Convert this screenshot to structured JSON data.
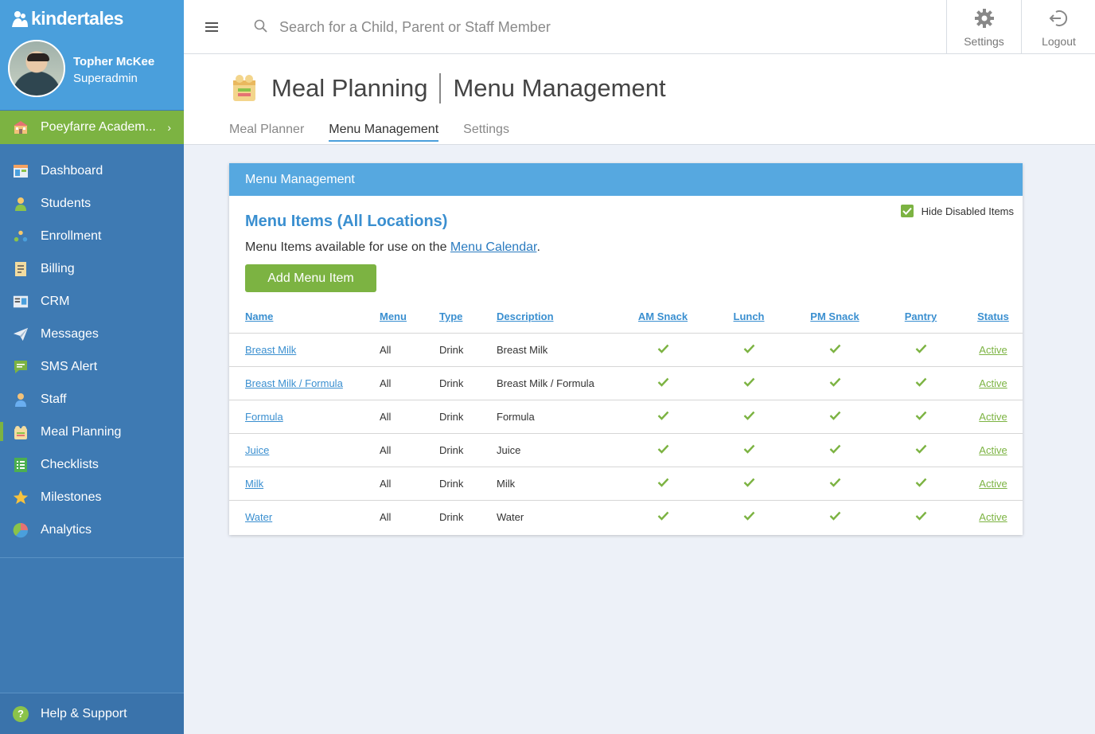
{
  "brand": {
    "name": "kindertales"
  },
  "user": {
    "name": "Topher McKee",
    "role": "Superadmin"
  },
  "school": {
    "name": "Poeyfarre Academ..."
  },
  "nav": [
    {
      "label": "Dashboard",
      "icon": "dashboard-icon",
      "color": "#e8eef5"
    },
    {
      "label": "Students",
      "icon": "students-icon",
      "color": "#f6c86a"
    },
    {
      "label": "Enrollment",
      "icon": "enrollment-icon",
      "color": "#f6c86a"
    },
    {
      "label": "Billing",
      "icon": "billing-icon",
      "color": "#f2dca0"
    },
    {
      "label": "CRM",
      "icon": "crm-icon",
      "color": "#e8eef5"
    },
    {
      "label": "Messages",
      "icon": "messages-icon",
      "color": "#e8eef5"
    },
    {
      "label": "SMS Alert",
      "icon": "sms-alert-icon",
      "color": "#7cb342"
    },
    {
      "label": "Staff",
      "icon": "staff-icon",
      "color": "#6aaef0"
    },
    {
      "label": "Meal Planning",
      "icon": "meal-planning-icon",
      "color": "#f2dca0",
      "active": true
    },
    {
      "label": "Checklists",
      "icon": "checklists-icon",
      "color": "#4caf50"
    },
    {
      "label": "Milestones",
      "icon": "milestones-icon",
      "color": "#f6c23e"
    },
    {
      "label": "Analytics",
      "icon": "analytics-icon",
      "color": "#e57373"
    }
  ],
  "help": {
    "label": "Help & Support"
  },
  "topbar": {
    "search_placeholder": "Search for a Child, Parent or Staff Member",
    "settings_label": "Settings",
    "logout_label": "Logout"
  },
  "page": {
    "title": "Meal Planning",
    "subtitle": "Menu Management",
    "tabs": [
      {
        "label": "Meal Planner",
        "active": false
      },
      {
        "label": "Menu Management",
        "active": true
      },
      {
        "label": "Settings",
        "active": false
      }
    ]
  },
  "card": {
    "header": "Menu Management",
    "title": "Menu Items (All Locations)",
    "desc_prefix": "Menu Items available for use on the ",
    "desc_link": "Menu Calendar",
    "desc_suffix": ".",
    "hide_disabled_label": "Hide Disabled Items",
    "hide_disabled_checked": true,
    "add_button": "Add Menu Item"
  },
  "table": {
    "columns": [
      "Name",
      "Menu",
      "Type",
      "Description",
      "AM Snack",
      "Lunch",
      "PM Snack",
      "Pantry",
      "Status"
    ],
    "rows": [
      {
        "name": "Breast Milk",
        "menu": "All",
        "type": "Drink",
        "description": "Breast Milk",
        "am_snack": true,
        "lunch": true,
        "pm_snack": true,
        "pantry": true,
        "status": "Active"
      },
      {
        "name": "Breast Milk / Formula",
        "menu": "All",
        "type": "Drink",
        "description": "Breast Milk / Formula",
        "am_snack": true,
        "lunch": true,
        "pm_snack": true,
        "pantry": true,
        "status": "Active"
      },
      {
        "name": "Formula",
        "menu": "All",
        "type": "Drink",
        "description": "Formula",
        "am_snack": true,
        "lunch": true,
        "pm_snack": true,
        "pantry": true,
        "status": "Active"
      },
      {
        "name": "Juice",
        "menu": "All",
        "type": "Drink",
        "description": "Juice",
        "am_snack": true,
        "lunch": true,
        "pm_snack": true,
        "pantry": true,
        "status": "Active"
      },
      {
        "name": "Milk",
        "menu": "All",
        "type": "Drink",
        "description": "Milk",
        "am_snack": true,
        "lunch": true,
        "pm_snack": true,
        "pantry": true,
        "status": "Active"
      },
      {
        "name": "Water",
        "menu": "All",
        "type": "Drink",
        "description": "Water",
        "am_snack": true,
        "lunch": true,
        "pm_snack": true,
        "pantry": true,
        "status": "Active"
      }
    ]
  },
  "colors": {
    "sidebar": "#3e7ab3",
    "sidebar_top": "#4a9fdc",
    "accent_green": "#7cb342",
    "link_blue": "#3a8fd0"
  }
}
